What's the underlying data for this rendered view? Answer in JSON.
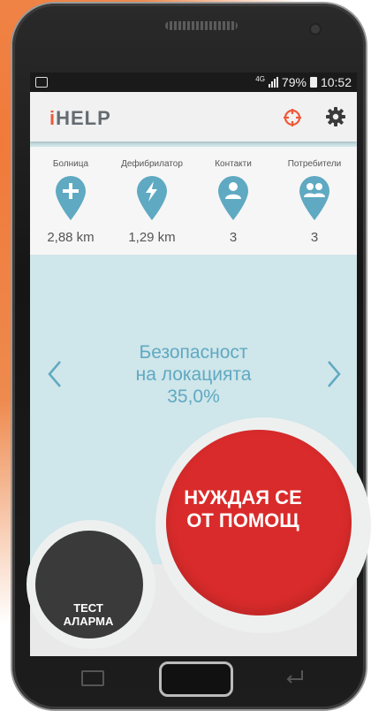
{
  "status": {
    "network": "4G",
    "battery": "79%",
    "time": "10:52"
  },
  "app": {
    "logo_i": "i",
    "logo_rest": "HELP",
    "accent": "#ee5a3a"
  },
  "stats": [
    {
      "label": "Болница",
      "value": "2,88 km",
      "icon": "hospital-cross-icon"
    },
    {
      "label": "Дефибрилатор",
      "value": "1,29 km",
      "icon": "lightning-icon"
    },
    {
      "label": "Контакти",
      "value": "3",
      "icon": "person-icon"
    },
    {
      "label": "Потребители",
      "value": "3",
      "icon": "group-icon"
    }
  ],
  "safety": {
    "line1": "Безопасност",
    "line2": "на локацията",
    "value": "35,0%"
  },
  "buttons": {
    "help_line1": "НУЖДАЯ СЕ",
    "help_line2": "ОТ ПОМОЩ",
    "test_line1": "ТЕСТ",
    "test_line2": "АЛАРМА",
    "help_color": "#d92b2b",
    "test_color": "#3a3a3a"
  }
}
